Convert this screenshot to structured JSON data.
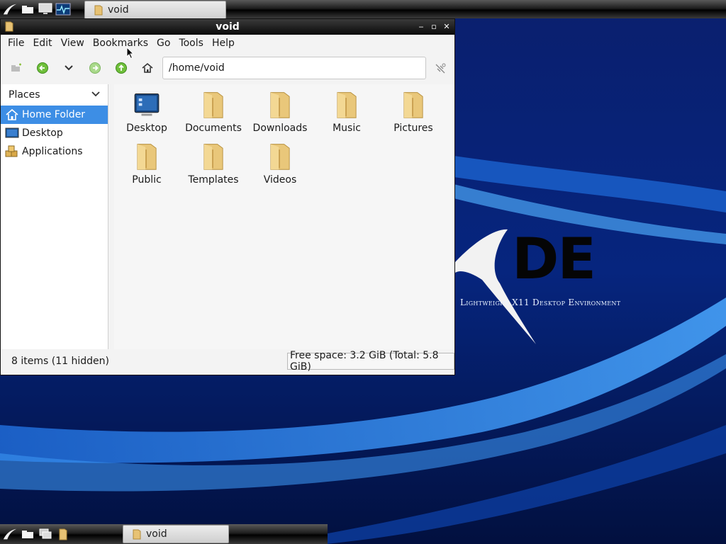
{
  "desktop": {
    "logo_text": "DE",
    "tagline": "Lightweight X11 Desktop Environment"
  },
  "top_panel": {
    "task_label": "void"
  },
  "bottom_panel": {
    "task_label": "void"
  },
  "window": {
    "title": "void",
    "menu": [
      "File",
      "Edit",
      "View",
      "Bookmarks",
      "Go",
      "Tools",
      "Help"
    ],
    "location": "/home/void",
    "sidebar": {
      "header": "Places",
      "items": [
        "Home Folder",
        "Desktop",
        "Applications"
      ]
    },
    "files": [
      "Desktop",
      "Documents",
      "Downloads",
      "Music",
      "Pictures",
      "Public",
      "Templates",
      "Videos"
    ],
    "status": {
      "items": "8 items (11 hidden)",
      "free_space": "Free space: 3.2 GiB (Total: 5.8 GiB)"
    }
  },
  "colors": {
    "selection": "#3d8ee5",
    "wallpaper": "#041a5a",
    "folder": "#e9c77a"
  }
}
